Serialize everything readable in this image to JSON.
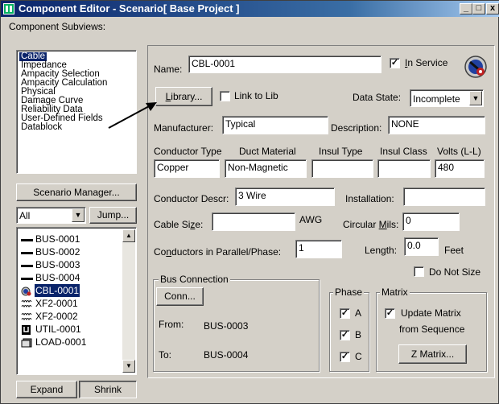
{
  "window": {
    "title": "Component Editor  - Scenario[ Base Project ]",
    "min_glyph": "_",
    "max_glyph": "□",
    "close_glyph": "x"
  },
  "subviews": {
    "label": "Component Subviews:",
    "items": [
      "Cable",
      "Impedance",
      "Ampacity Selection",
      "Ampacity Calculation",
      "Physical",
      "Damage Curve",
      "Reliability Data",
      "User-Defined Fields",
      "Datablock"
    ],
    "selected_index": 0
  },
  "scenario_manager_label": "Scenario Manager...",
  "filter": {
    "value": "All"
  },
  "jump_label": "Jump...",
  "tree": {
    "items": [
      {
        "icon": "bus-icon",
        "label": "BUS-0001",
        "selected": false
      },
      {
        "icon": "bus-icon",
        "label": "BUS-0002",
        "selected": false
      },
      {
        "icon": "bus-icon",
        "label": "BUS-0003",
        "selected": false
      },
      {
        "icon": "bus-icon",
        "label": "BUS-0004",
        "selected": false
      },
      {
        "icon": "cable-icon",
        "label": "CBL-0001",
        "selected": true
      },
      {
        "icon": "transformer-icon",
        "label": "XF2-0001",
        "selected": false
      },
      {
        "icon": "transformer-icon",
        "label": "XF2-0002",
        "selected": false
      },
      {
        "icon": "utility-icon",
        "label": "UTIL-0001",
        "selected": false
      },
      {
        "icon": "load-icon",
        "label": "LOAD-0001",
        "selected": false
      }
    ]
  },
  "expand_label": "Expand",
  "shrink_label": "Shrink",
  "cable": {
    "name_label": "Name:",
    "name_value": "CBL-0001",
    "in_service_label": "In Service",
    "in_service_checked": true,
    "library_label": "Library...",
    "link_to_lib_label": "Link to Lib",
    "link_to_lib_checked": false,
    "data_state_label": "Data State:",
    "data_state_value": "Incomplete",
    "manufacturer_label": "Manufacturer:",
    "manufacturer_value": "Typical",
    "description_label": "Description:",
    "description_value": "NONE",
    "conductor_type_label": "Conductor Type",
    "conductor_type_value": "Copper",
    "duct_material_label": "Duct Material",
    "duct_material_value": "Non-Magnetic",
    "insul_type_label": "Insul Type",
    "insul_type_value": "",
    "insul_class_label": "Insul Class",
    "insul_class_value": "",
    "volts_label": "Volts (L-L)",
    "volts_value": "480",
    "conductor_descr_label": "Conductor Descr:",
    "conductor_descr_value": "3 Wire",
    "installation_label": "Installation:",
    "installation_value": "",
    "cable_size_label": "Cable Size:",
    "cable_size_value": "",
    "awg_label": "AWG",
    "circular_mils_label": "Circular Mils:",
    "circular_mils_value": "0",
    "conductors_parallel_label": "Conductors in Parallel/Phase:",
    "conductors_parallel_value": "1",
    "length_label": "Length:",
    "length_value": "0.0",
    "feet_label": "Feet",
    "do_not_size_label": "Do Not Size",
    "do_not_size_checked": false
  },
  "bus_connection": {
    "title": "Bus Connection",
    "conn_label": "Conn...",
    "from_label": "From:",
    "from_value": "BUS-0003",
    "to_label": "To:",
    "to_value": "BUS-0004"
  },
  "phase": {
    "title": "Phase",
    "a_label": "A",
    "a_checked": true,
    "b_label": "B",
    "b_checked": true,
    "c_label": "C",
    "c_checked": true
  },
  "matrix": {
    "title": "Matrix",
    "update_label_1": "Update Matrix",
    "update_label_2": "from Sequence",
    "update_checked": true,
    "zmatrix_label": "Z Matrix..."
  },
  "colors": {
    "selection": "#0a246a",
    "face": "#d4d0c8"
  }
}
